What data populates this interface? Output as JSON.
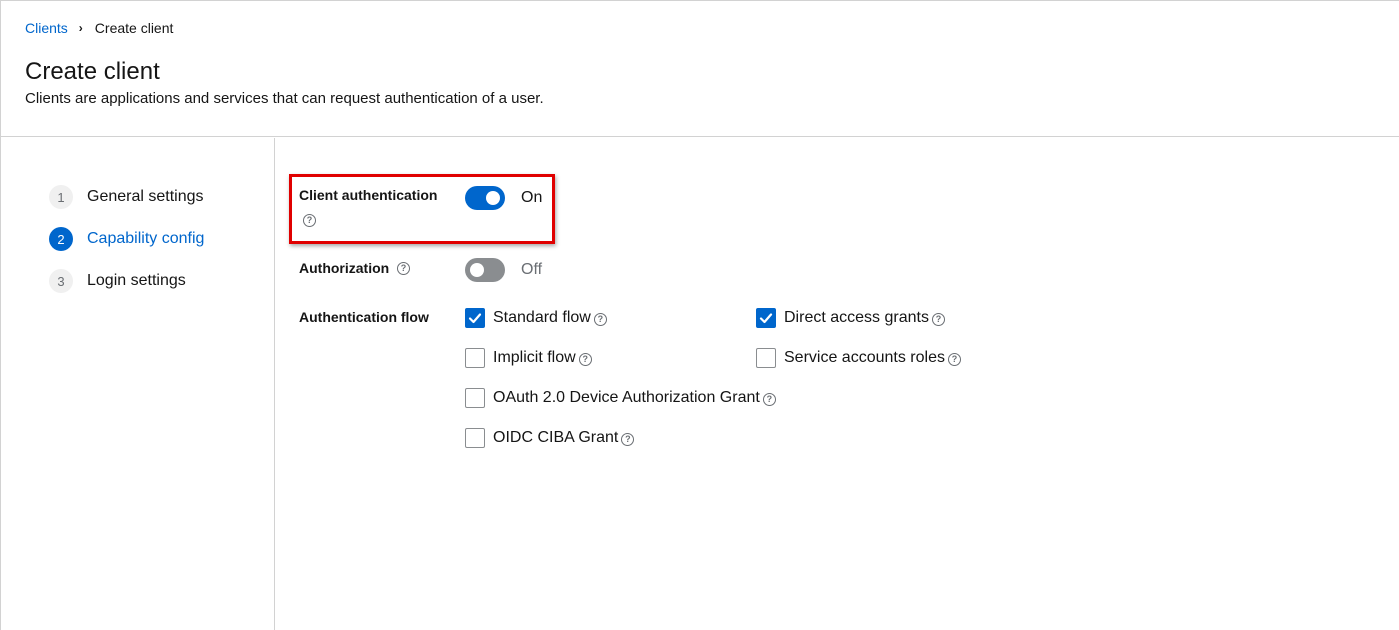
{
  "breadcrumb": {
    "parent": "Clients",
    "current": "Create client"
  },
  "header": {
    "title": "Create client",
    "description": "Clients are applications and services that can request authentication of a user."
  },
  "wizard": {
    "steps": [
      {
        "number": "1",
        "label": "General settings",
        "active": false
      },
      {
        "number": "2",
        "label": "Capability config",
        "active": true
      },
      {
        "number": "3",
        "label": "Login settings",
        "active": false
      }
    ]
  },
  "form": {
    "client_authentication": {
      "label": "Client authentication",
      "enabled": true,
      "state_text": "On"
    },
    "authorization": {
      "label": "Authorization",
      "enabled": false,
      "state_text": "Off"
    },
    "authentication_flow": {
      "label": "Authentication flow",
      "options": [
        {
          "label": "Standard flow",
          "checked": true
        },
        {
          "label": "Direct access grants",
          "checked": true
        },
        {
          "label": "Implicit flow",
          "checked": false
        },
        {
          "label": "Service accounts roles",
          "checked": false
        },
        {
          "label": "OAuth 2.0 Device Authorization Grant",
          "checked": false
        },
        {
          "label": "OIDC CIBA Grant",
          "checked": false
        }
      ]
    }
  },
  "icons": {
    "help": "question-circle-icon",
    "breadcrumb_separator": "chevron-right-icon",
    "check": "check-icon"
  },
  "colors": {
    "accent": "#0066cc",
    "highlight": "#e00000",
    "switch_off": "#8a8d90"
  }
}
